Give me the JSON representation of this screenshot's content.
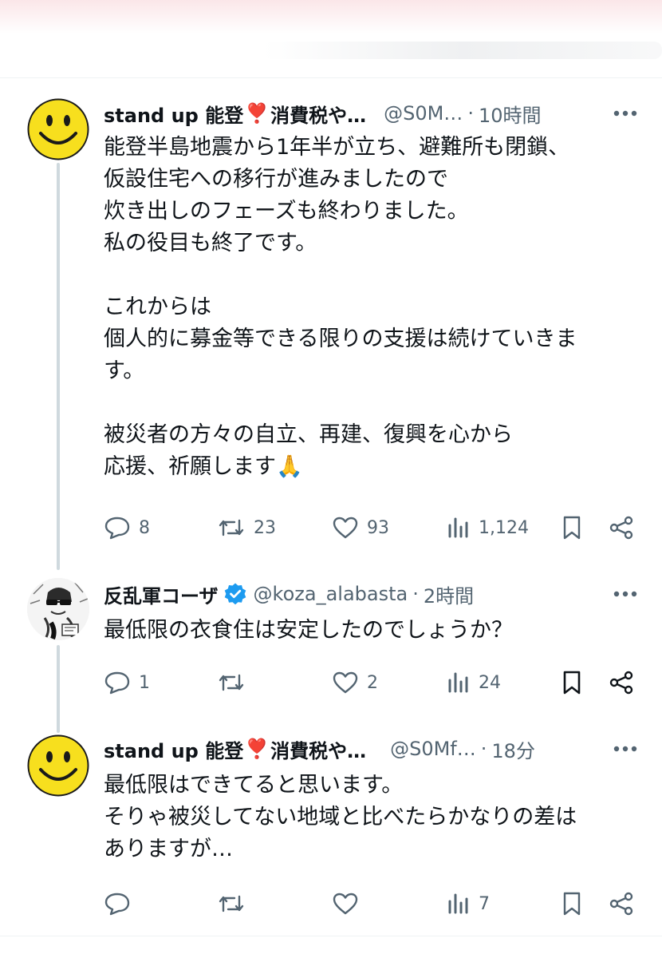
{
  "tweets": [
    {
      "name": "stand up 能登",
      "heart_emoji": "❣️",
      "name_suffix": "消費税や…",
      "handle": "@S0M…",
      "time": "10時間",
      "text": "能登半島地震から1年半が立ち、避難所も閉鎖、\n仮設住宅への移行が進みましたので\n炊き出しのフェーズも終わりました。\n私の役目も終了です。\n\nこれからは\n個人的に募金等できる限りの支援は続けていきま\nす。\n\n被災者の方々の自立、再建、復興を心から\n応援、祈願します🙏",
      "replies": "8",
      "retweets": "23",
      "likes": "93",
      "views": "1,124"
    },
    {
      "name": "反乱軍コーザ",
      "verified": true,
      "handle": "@koza_alabasta",
      "time": "2時間",
      "text": "最低限の衣食住は安定したのでしょうか？",
      "replies": "1",
      "retweets": "",
      "likes": "2",
      "views": "24"
    },
    {
      "name": "stand up 能登",
      "heart_emoji": "❣️",
      "name_suffix": "消費税や…",
      "handle": "@S0Mf…",
      "time": "18分",
      "text": "最低限はできてると思います。\nそりゃ被災してない地域と比べたらかなりの差は\nありますが…",
      "replies": "",
      "retweets": "",
      "likes": "",
      "views": "7"
    }
  ],
  "separator": "·",
  "colors": {
    "text": "#0f1419",
    "muted": "#536471",
    "verified": "#1d9bf0",
    "thread_line": "#cfd9de",
    "smiley": "#f7df1e"
  },
  "icons": [
    "smiley-avatar-icon",
    "more-icon",
    "reply-icon",
    "retweet-icon",
    "like-icon",
    "views-icon",
    "bookmark-icon",
    "share-icon",
    "verified-badge-icon"
  ]
}
